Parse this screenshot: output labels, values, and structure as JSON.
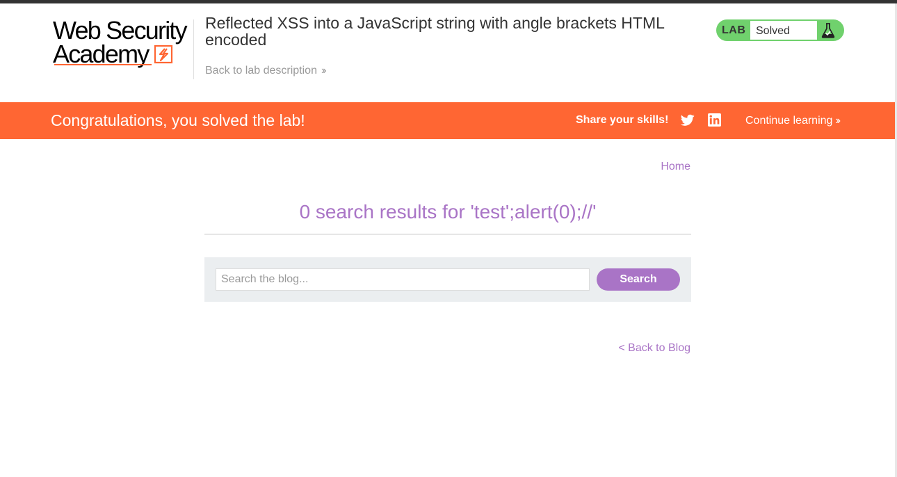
{
  "header": {
    "logo_line1": "Web Security",
    "logo_line2": "Academy",
    "lab_title": "Reflected XSS into a JavaScript string with angle brackets HTML encoded",
    "back_to_description": "Back to lab description",
    "status_tag": "LAB",
    "status_value": "Solved"
  },
  "banner": {
    "message": "Congratulations, you solved the lab!",
    "share_label": "Share your skills!",
    "continue_label": "Continue learning"
  },
  "main": {
    "home_link": "Home",
    "results_heading": "0 search results for 'test';alert(0);//'",
    "search": {
      "placeholder": "Search the blog...",
      "value": "",
      "button_label": "Search"
    },
    "back_link": "< Back to Blog"
  },
  "colors": {
    "brand_orange": "#ff6633",
    "accent_purple": "#a974c6",
    "status_green": "#70d16d"
  },
  "icons": [
    "twitter-icon",
    "linkedin-icon",
    "flask-icon",
    "chevron-double-right-icon"
  ]
}
